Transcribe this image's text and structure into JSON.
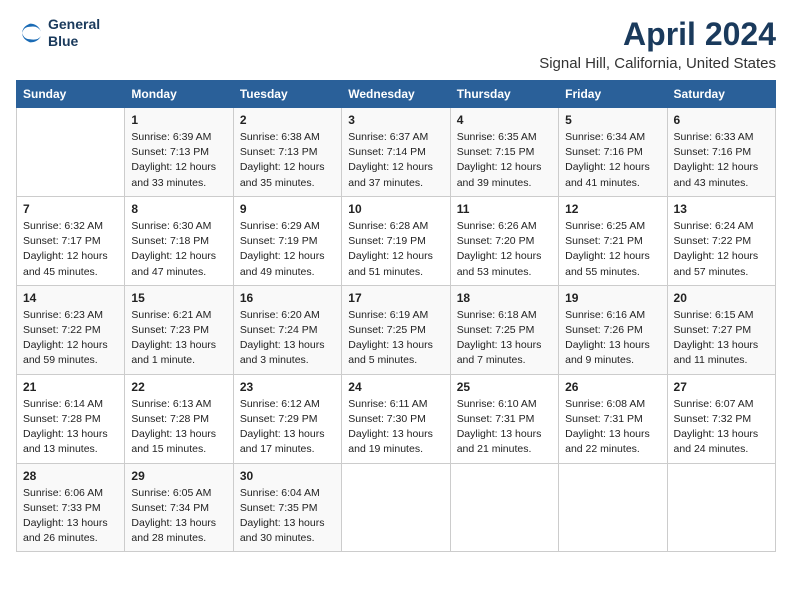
{
  "header": {
    "logo_line1": "General",
    "logo_line2": "Blue",
    "title": "April 2024",
    "subtitle": "Signal Hill, California, United States"
  },
  "days_of_week": [
    "Sunday",
    "Monday",
    "Tuesday",
    "Wednesday",
    "Thursday",
    "Friday",
    "Saturday"
  ],
  "weeks": [
    [
      {
        "num": "",
        "info": ""
      },
      {
        "num": "1",
        "info": "Sunrise: 6:39 AM\nSunset: 7:13 PM\nDaylight: 12 hours\nand 33 minutes."
      },
      {
        "num": "2",
        "info": "Sunrise: 6:38 AM\nSunset: 7:13 PM\nDaylight: 12 hours\nand 35 minutes."
      },
      {
        "num": "3",
        "info": "Sunrise: 6:37 AM\nSunset: 7:14 PM\nDaylight: 12 hours\nand 37 minutes."
      },
      {
        "num": "4",
        "info": "Sunrise: 6:35 AM\nSunset: 7:15 PM\nDaylight: 12 hours\nand 39 minutes."
      },
      {
        "num": "5",
        "info": "Sunrise: 6:34 AM\nSunset: 7:16 PM\nDaylight: 12 hours\nand 41 minutes."
      },
      {
        "num": "6",
        "info": "Sunrise: 6:33 AM\nSunset: 7:16 PM\nDaylight: 12 hours\nand 43 minutes."
      }
    ],
    [
      {
        "num": "7",
        "info": "Sunrise: 6:32 AM\nSunset: 7:17 PM\nDaylight: 12 hours\nand 45 minutes."
      },
      {
        "num": "8",
        "info": "Sunrise: 6:30 AM\nSunset: 7:18 PM\nDaylight: 12 hours\nand 47 minutes."
      },
      {
        "num": "9",
        "info": "Sunrise: 6:29 AM\nSunset: 7:19 PM\nDaylight: 12 hours\nand 49 minutes."
      },
      {
        "num": "10",
        "info": "Sunrise: 6:28 AM\nSunset: 7:19 PM\nDaylight: 12 hours\nand 51 minutes."
      },
      {
        "num": "11",
        "info": "Sunrise: 6:26 AM\nSunset: 7:20 PM\nDaylight: 12 hours\nand 53 minutes."
      },
      {
        "num": "12",
        "info": "Sunrise: 6:25 AM\nSunset: 7:21 PM\nDaylight: 12 hours\nand 55 minutes."
      },
      {
        "num": "13",
        "info": "Sunrise: 6:24 AM\nSunset: 7:22 PM\nDaylight: 12 hours\nand 57 minutes."
      }
    ],
    [
      {
        "num": "14",
        "info": "Sunrise: 6:23 AM\nSunset: 7:22 PM\nDaylight: 12 hours\nand 59 minutes."
      },
      {
        "num": "15",
        "info": "Sunrise: 6:21 AM\nSunset: 7:23 PM\nDaylight: 13 hours\nand 1 minute."
      },
      {
        "num": "16",
        "info": "Sunrise: 6:20 AM\nSunset: 7:24 PM\nDaylight: 13 hours\nand 3 minutes."
      },
      {
        "num": "17",
        "info": "Sunrise: 6:19 AM\nSunset: 7:25 PM\nDaylight: 13 hours\nand 5 minutes."
      },
      {
        "num": "18",
        "info": "Sunrise: 6:18 AM\nSunset: 7:25 PM\nDaylight: 13 hours\nand 7 minutes."
      },
      {
        "num": "19",
        "info": "Sunrise: 6:16 AM\nSunset: 7:26 PM\nDaylight: 13 hours\nand 9 minutes."
      },
      {
        "num": "20",
        "info": "Sunrise: 6:15 AM\nSunset: 7:27 PM\nDaylight: 13 hours\nand 11 minutes."
      }
    ],
    [
      {
        "num": "21",
        "info": "Sunrise: 6:14 AM\nSunset: 7:28 PM\nDaylight: 13 hours\nand 13 minutes."
      },
      {
        "num": "22",
        "info": "Sunrise: 6:13 AM\nSunset: 7:28 PM\nDaylight: 13 hours\nand 15 minutes."
      },
      {
        "num": "23",
        "info": "Sunrise: 6:12 AM\nSunset: 7:29 PM\nDaylight: 13 hours\nand 17 minutes."
      },
      {
        "num": "24",
        "info": "Sunrise: 6:11 AM\nSunset: 7:30 PM\nDaylight: 13 hours\nand 19 minutes."
      },
      {
        "num": "25",
        "info": "Sunrise: 6:10 AM\nSunset: 7:31 PM\nDaylight: 13 hours\nand 21 minutes."
      },
      {
        "num": "26",
        "info": "Sunrise: 6:08 AM\nSunset: 7:31 PM\nDaylight: 13 hours\nand 22 minutes."
      },
      {
        "num": "27",
        "info": "Sunrise: 6:07 AM\nSunset: 7:32 PM\nDaylight: 13 hours\nand 24 minutes."
      }
    ],
    [
      {
        "num": "28",
        "info": "Sunrise: 6:06 AM\nSunset: 7:33 PM\nDaylight: 13 hours\nand 26 minutes."
      },
      {
        "num": "29",
        "info": "Sunrise: 6:05 AM\nSunset: 7:34 PM\nDaylight: 13 hours\nand 28 minutes."
      },
      {
        "num": "30",
        "info": "Sunrise: 6:04 AM\nSunset: 7:35 PM\nDaylight: 13 hours\nand 30 minutes."
      },
      {
        "num": "",
        "info": ""
      },
      {
        "num": "",
        "info": ""
      },
      {
        "num": "",
        "info": ""
      },
      {
        "num": "",
        "info": ""
      }
    ]
  ]
}
